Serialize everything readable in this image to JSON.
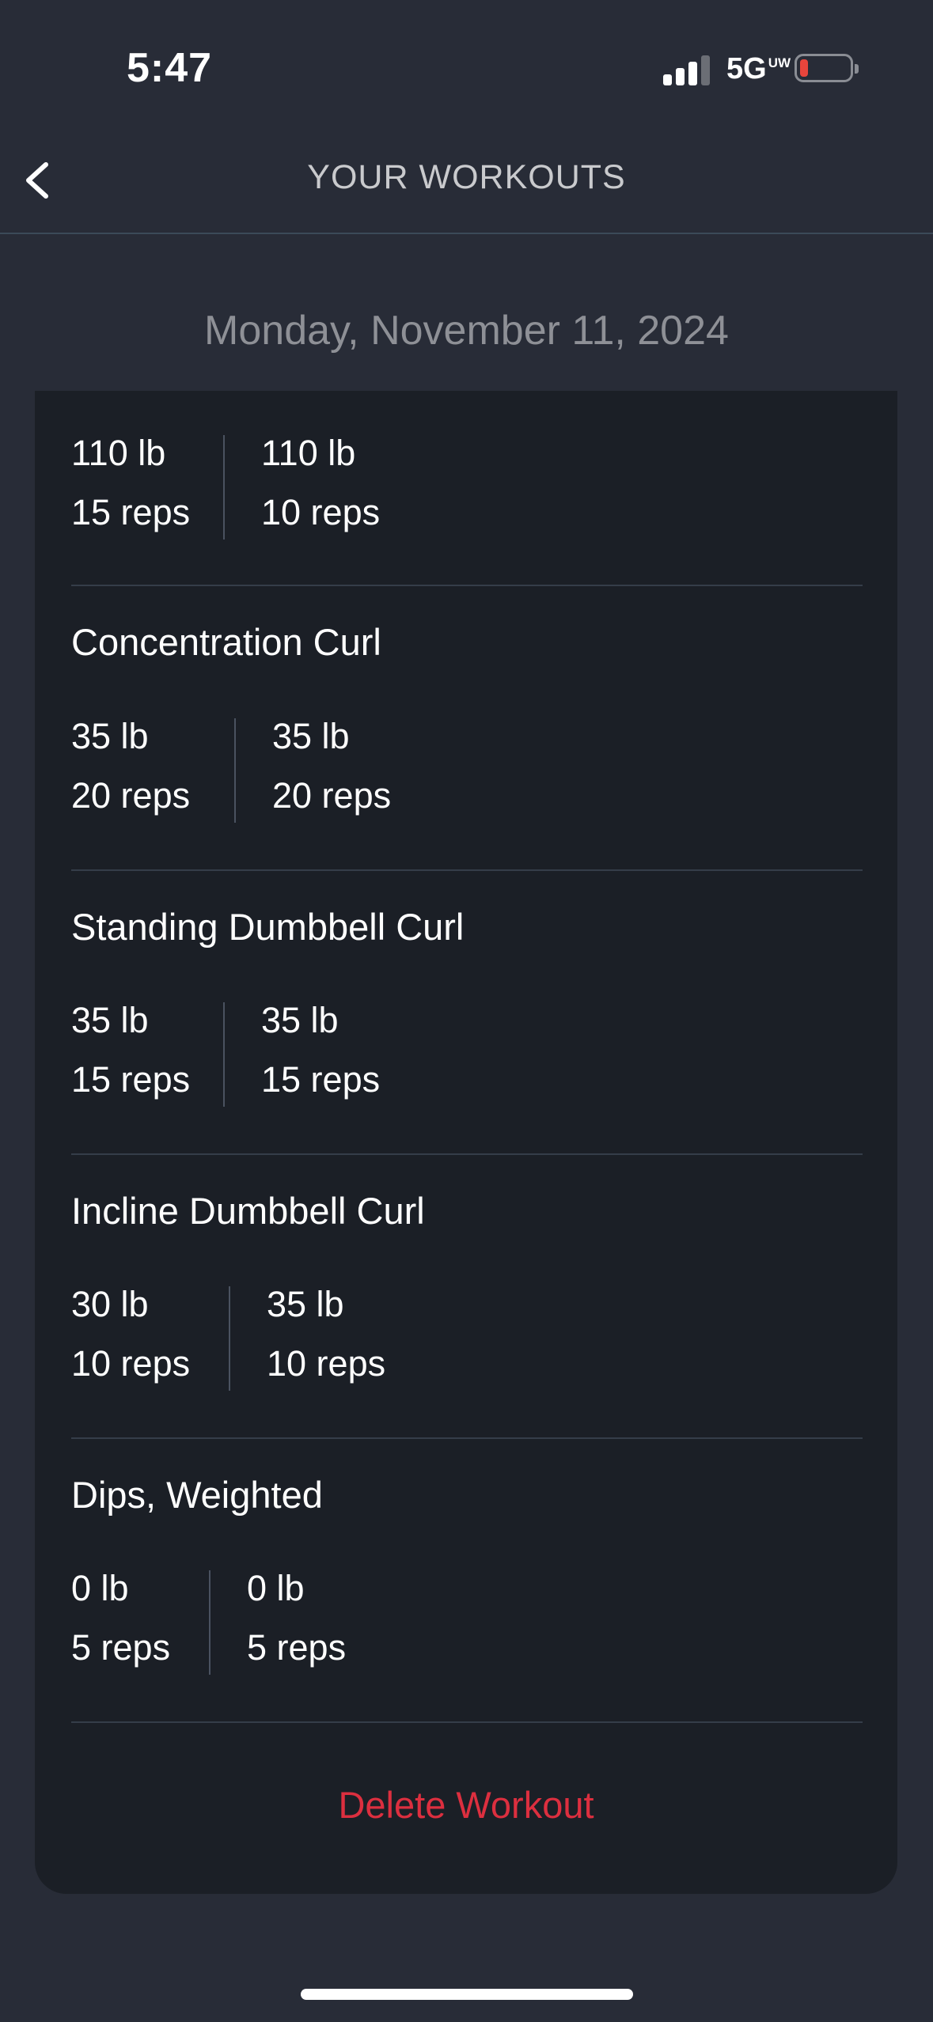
{
  "status": {
    "time": "5:47",
    "network": "5G",
    "network_suffix": "UW"
  },
  "header": {
    "title": "YOUR WORKOUTS"
  },
  "date": "Monday, November 11, 2024",
  "exercises": [
    {
      "name": "",
      "sets": [
        {
          "weight": "110 lb",
          "reps": "15 reps"
        },
        {
          "weight": "110 lb",
          "reps": "10 reps"
        }
      ]
    },
    {
      "name": "Concentration Curl",
      "sets": [
        {
          "weight": "35 lb",
          "reps": "20 reps"
        },
        {
          "weight": "35 lb",
          "reps": "20 reps"
        }
      ]
    },
    {
      "name": "Standing Dumbbell Curl",
      "sets": [
        {
          "weight": "35 lb",
          "reps": "15 reps"
        },
        {
          "weight": "35 lb",
          "reps": "15 reps"
        }
      ]
    },
    {
      "name": "Incline Dumbbell Curl",
      "sets": [
        {
          "weight": "30 lb",
          "reps": "10 reps"
        },
        {
          "weight": "35 lb",
          "reps": "10 reps"
        }
      ]
    },
    {
      "name": "Dips, Weighted",
      "sets": [
        {
          "weight": "0 lb",
          "reps": "5 reps"
        },
        {
          "weight": "0 lb",
          "reps": "5 reps"
        }
      ]
    }
  ],
  "actions": {
    "delete_label": "Delete Workout"
  },
  "colors": {
    "background": "#282c37",
    "card": "#1b1f26",
    "danger": "#dc2f3f",
    "muted_text": "#8e9096"
  }
}
